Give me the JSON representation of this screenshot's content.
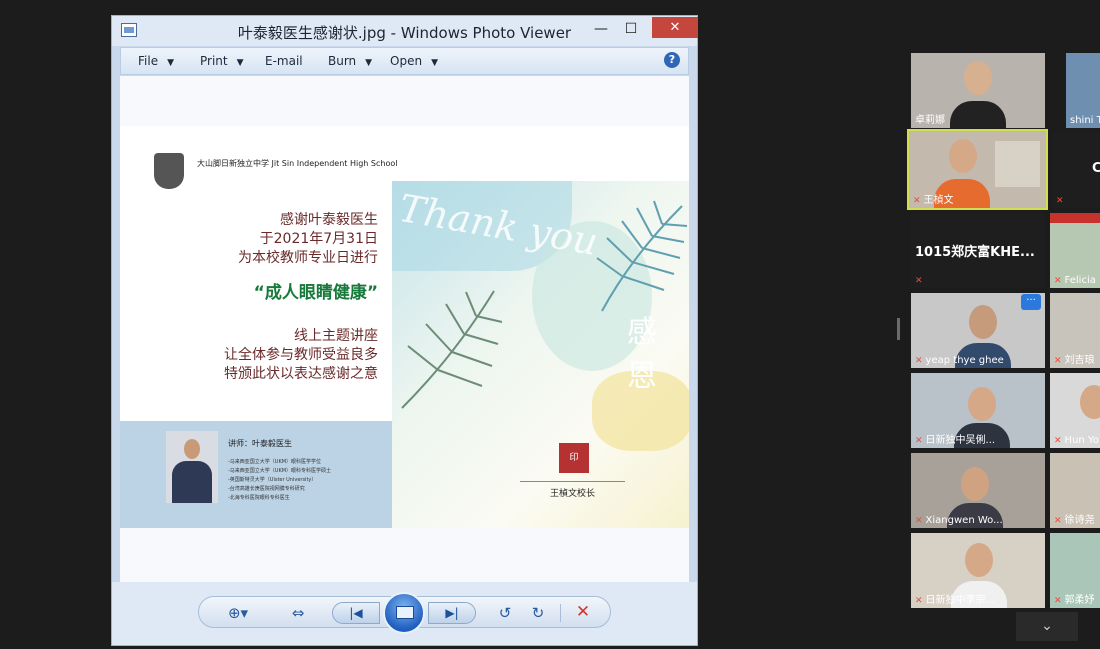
{
  "window": {
    "title": "叶泰毅医生感谢状.jpg - Windows Photo Viewer",
    "minimize": "—",
    "maximize": "☐",
    "close": "✕"
  },
  "toolbar": {
    "file": "File",
    "print": "Print",
    "email": "E-mail",
    "burn": "Burn",
    "open": "Open",
    "help": "?"
  },
  "certificate": {
    "school_name": "大山脚日新独立中学  Jit Sin Independent High School",
    "thanks_to": "感谢叶泰毅医生",
    "date_line": "于2021年7月31日",
    "purpose_line": "为本校教师专业日进行",
    "topic": "“成人眼睛健康”",
    "online_line": "线上主题讲座",
    "benefit_line": "让全体参与教师受益良多",
    "gratitude_line": "特颁此状以表达感谢之意",
    "script_text": "Thank you",
    "gan_en": "感恩",
    "seal_text": "印",
    "principal": "王楨文校长",
    "speaker_name": "讲师：叶泰毅医生",
    "credentials": [
      "-马来西亚国立大学（UKM）眼科医学学位",
      "-马来西亚国立大学（UKM）眼科专科医学硕士",
      "-英国斯特灵大学（Ulster University）",
      "-台湾高雄长庚医院视网膜专科研究",
      "-北海专科医院眼科专科医生"
    ]
  },
  "controls": {
    "zoom": "⊕▾",
    "fit": "⇔",
    "prev": "|◀",
    "next": "▶|",
    "rotate_ccw": "↺",
    "rotate_cw": "↻",
    "delete": "✕"
  },
  "participants": [
    {
      "name": "卓莉娜"
    },
    {
      "name": "shini Ta"
    },
    {
      "name": "王楨文"
    },
    {
      "name": "C"
    },
    {
      "name": "1015郑庆富KHE..."
    },
    {
      "name": "Felicia"
    },
    {
      "name": "yeap thye ghee"
    },
    {
      "name": "刘吉琅"
    },
    {
      "name": "日新独中吴俐..."
    },
    {
      "name": "Hun Yo"
    },
    {
      "name": "Xiangwen Wo..."
    },
    {
      "name": "徐诗尧"
    },
    {
      "name": "日新独中李宗..."
    },
    {
      "name": "郭柔妤"
    }
  ],
  "ui": {
    "more": "···",
    "scroll_down": "⌄",
    "mic_muted_icon": "mic-off-icon"
  }
}
